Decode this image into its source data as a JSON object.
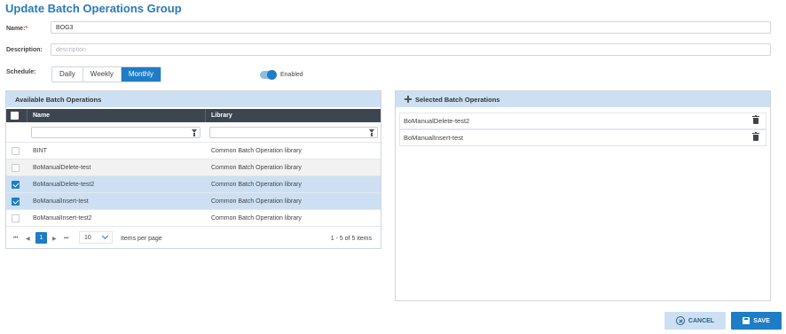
{
  "page": {
    "title": "Update Batch Operations Group"
  },
  "form": {
    "name_label": "Name:",
    "name_required_mark": "*",
    "name_value": "BOG3",
    "description_label": "Description:",
    "description_placeholder": "description",
    "schedule_label": "Schedule:",
    "schedule_options": [
      "Daily",
      "Weekly",
      "Monthly"
    ],
    "schedule_selected": "Monthly",
    "enabled_label": "Enabled",
    "enabled": true
  },
  "available": {
    "title": "Available Batch Operations",
    "columns": {
      "name": "Name",
      "library": "Library"
    },
    "rows": [
      {
        "name": "BINT",
        "library": "Common Batch Operation library",
        "checked": false
      },
      {
        "name": "BoManualDelete-test",
        "library": "Common Batch Operation library",
        "checked": false
      },
      {
        "name": "BoManualDelete-test2",
        "library": "Common Batch Operation library",
        "checked": true
      },
      {
        "name": "BoManualInsert-test",
        "library": "Common Batch Operation library",
        "checked": true
      },
      {
        "name": "BoManualInsert-test2",
        "library": "Common Batch Operation library",
        "checked": false
      }
    ],
    "pager": {
      "nav_first": "⏮",
      "nav_prev": "◀",
      "nav_next": "▶",
      "nav_last": "⏭",
      "current_page": "1",
      "page_size": "10",
      "items_per_page_label": "Items per page",
      "range_text": "1 - 5 of 5 items"
    }
  },
  "selected": {
    "title": "Selected Batch Operations",
    "items": [
      {
        "name": "BoManualDelete-test2"
      },
      {
        "name": "BoManualInsert-test"
      }
    ]
  },
  "actions": {
    "cancel_label": "CANCEL",
    "save_label": "SAVE"
  },
  "colors": {
    "accent": "#1e7dc6",
    "title": "#2a7ab8",
    "panel_head": "#cde0f3",
    "grid_header": "#3d4650"
  }
}
